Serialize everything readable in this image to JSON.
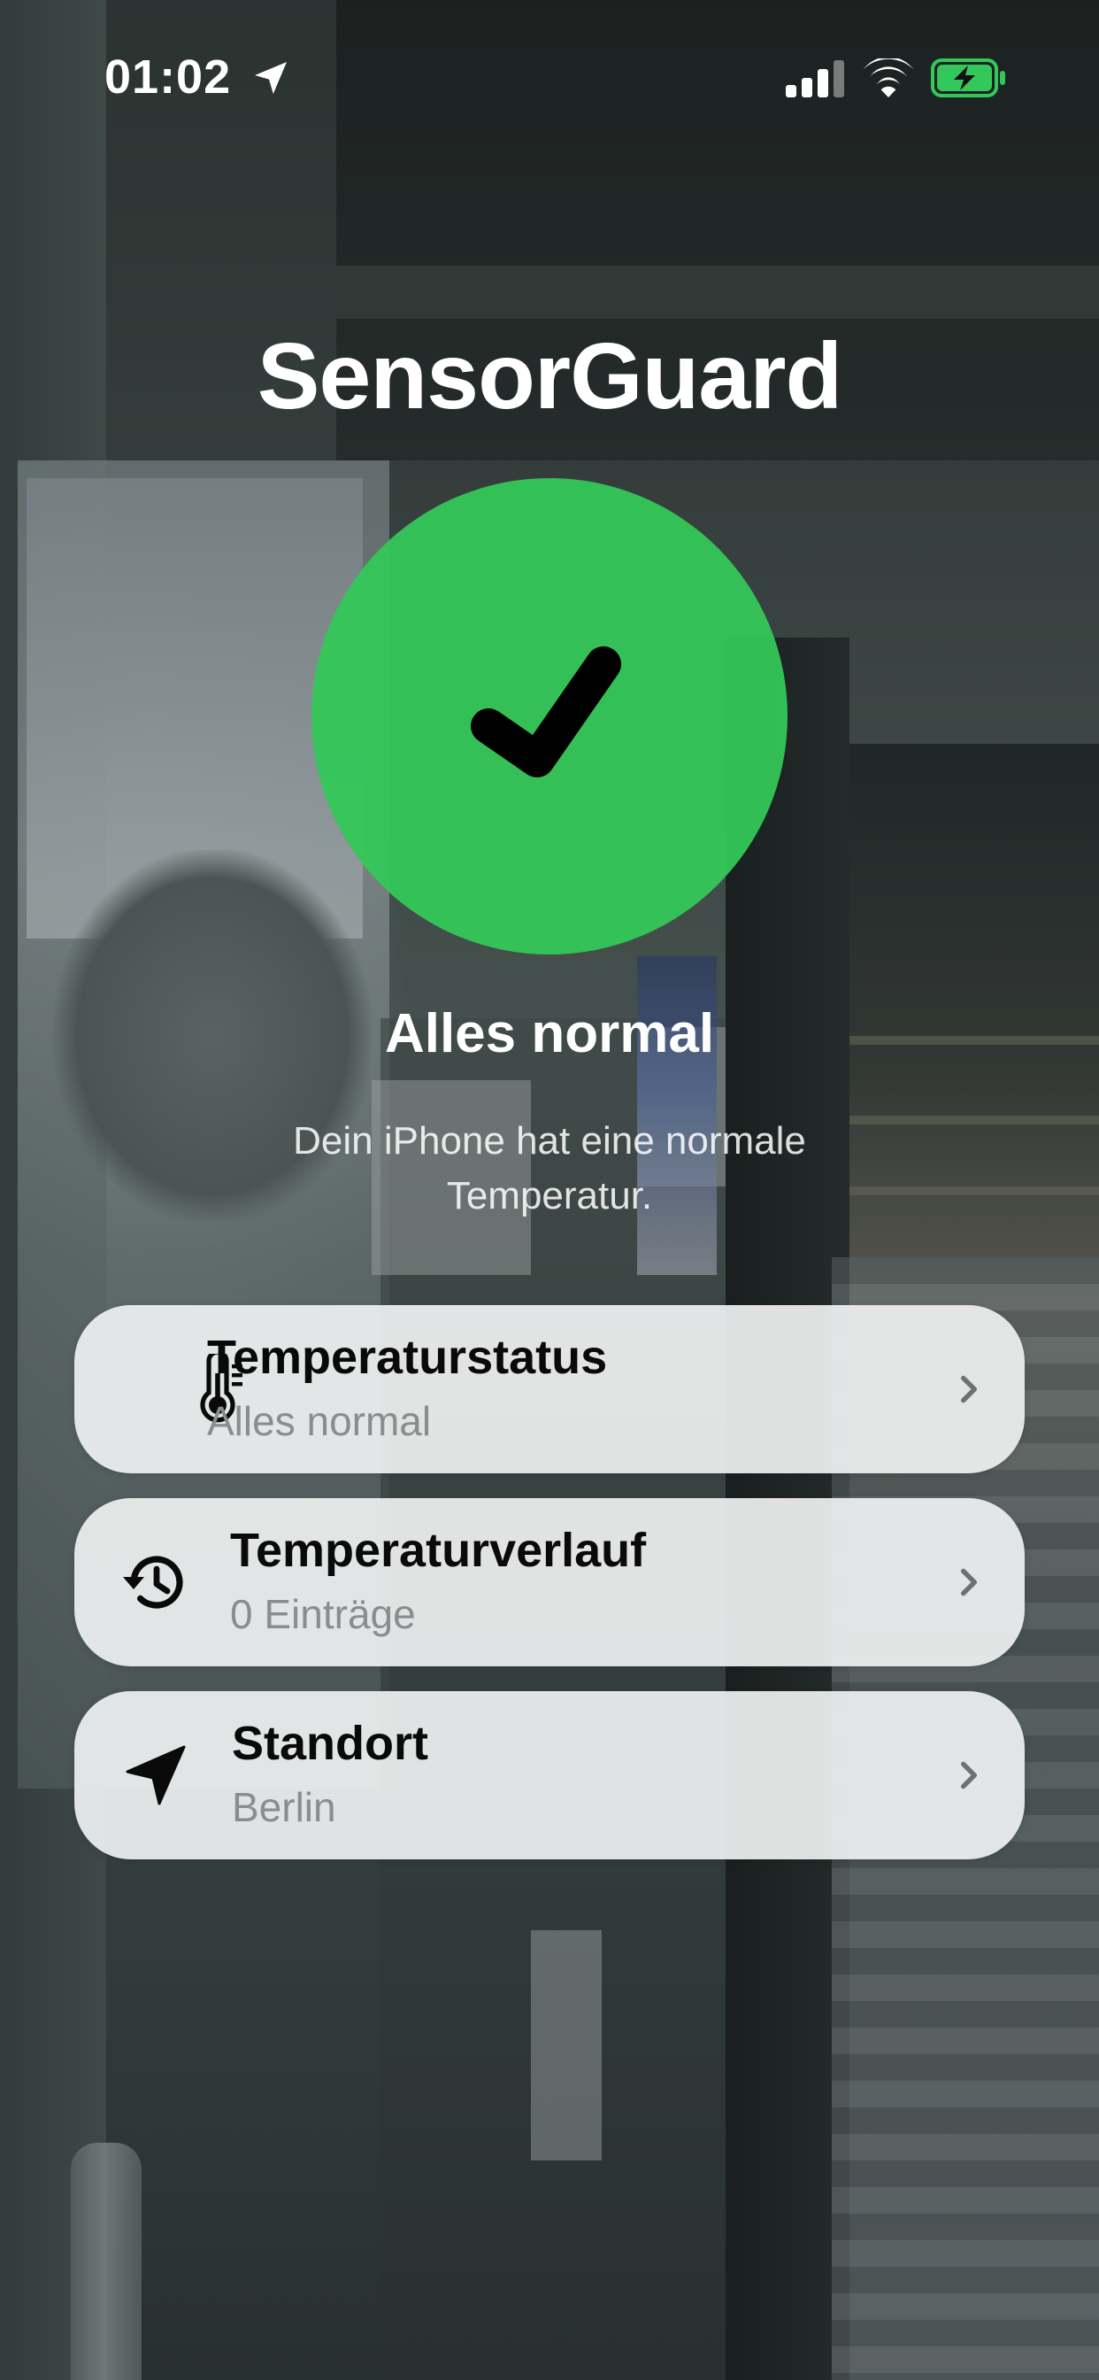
{
  "status_bar": {
    "time": "01:02",
    "icons": [
      "location-arrow-icon",
      "signal-icon",
      "wifi-icon",
      "battery-charging-icon"
    ]
  },
  "app": {
    "title": "SensorGuard"
  },
  "status": {
    "icon": "checkmark-icon",
    "color": "#34c759",
    "heading": "Alles normal",
    "description": "Dein iPhone hat eine normale Temperatur."
  },
  "cards": [
    {
      "icon": "thermometer-icon",
      "title": "Temperaturstatus",
      "subtitle": "Alles normal"
    },
    {
      "icon": "history-icon",
      "title": "Temperaturverlauf",
      "subtitle": "0 Einträge"
    },
    {
      "icon": "location-arrow-icon",
      "title": "Standort",
      "subtitle": "Berlin"
    }
  ]
}
